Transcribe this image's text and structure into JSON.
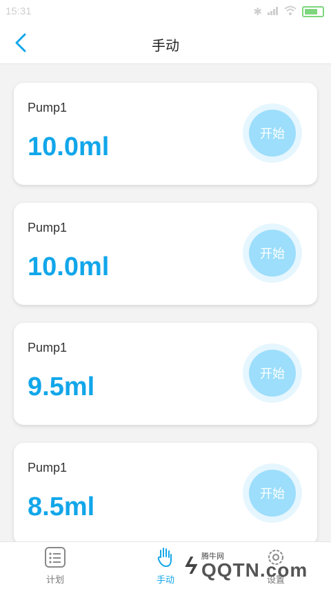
{
  "status_bar": {
    "time": "15:31"
  },
  "header": {
    "title": "手动"
  },
  "pumps": [
    {
      "name": "Pump1",
      "amount": "10.0ml",
      "button": "开始"
    },
    {
      "name": "Pump1",
      "amount": "10.0ml",
      "button": "开始"
    },
    {
      "name": "Pump1",
      "amount": "9.5ml",
      "button": "开始"
    },
    {
      "name": "Pump1",
      "amount": "8.5ml",
      "button": "开始"
    }
  ],
  "tabs": [
    {
      "label": "计划",
      "icon": "list-icon"
    },
    {
      "label": "手动",
      "icon": "hand-icon"
    },
    {
      "label": "设置",
      "icon": "gear-icon"
    }
  ],
  "watermark": {
    "small": "腾牛网",
    "big": "QQTN.com"
  },
  "colors": {
    "accent": "#12a6ea",
    "button": "#9cdefc"
  }
}
